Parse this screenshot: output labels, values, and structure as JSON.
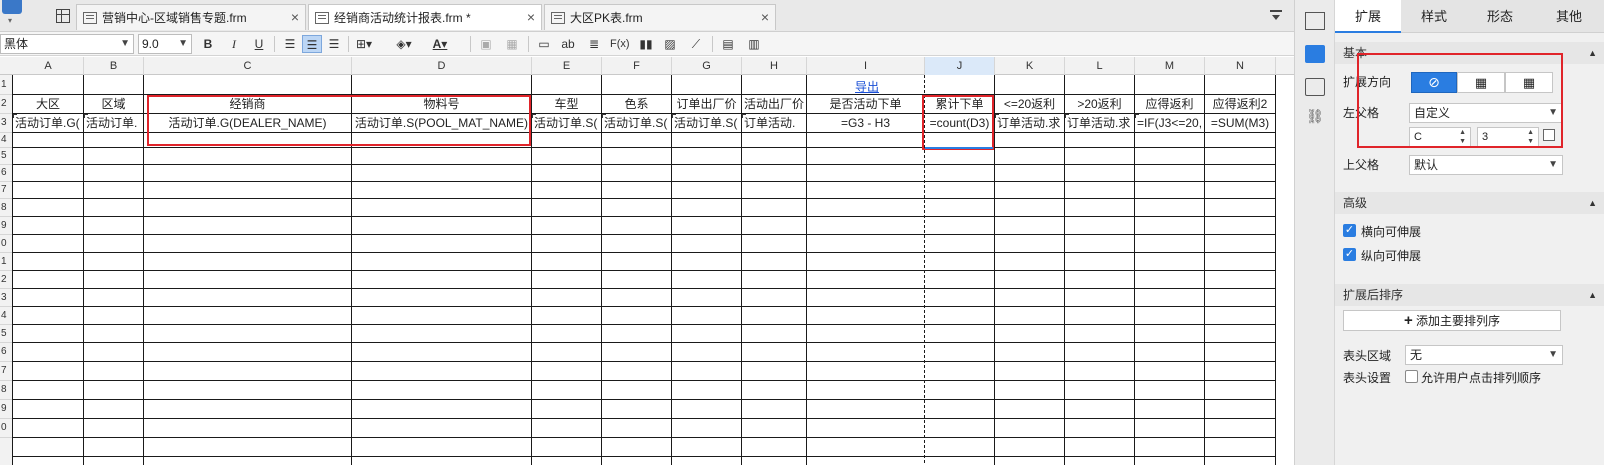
{
  "tabs": [
    {
      "label": "营销中心-区域销售专题.frm",
      "close": "×"
    },
    {
      "label": "经销商活动统计报表.frm *",
      "close": "×"
    },
    {
      "label": "大区PK表.frm",
      "close": "×"
    }
  ],
  "toolbar": {
    "font_name": "黑体",
    "font_size": "9.0",
    "bold": "B",
    "italic": "I",
    "underline": "U",
    "text_icon": "ab",
    "formula": "F(x)"
  },
  "columns": [
    "A",
    "B",
    "C",
    "D",
    "E",
    "F",
    "G",
    "H",
    "I",
    "J",
    "K",
    "L",
    "M",
    "N"
  ],
  "rows": [
    "1",
    "2",
    "3",
    "4",
    "5",
    "6",
    "7",
    "8",
    "9",
    "0",
    "1",
    "2",
    "3",
    "4",
    "5",
    "6",
    "7",
    "8",
    "9",
    "0"
  ],
  "sheet": {
    "export_link": "导出",
    "headers": [
      "大区",
      "区域",
      "经销商",
      "物料号",
      "车型",
      "色系",
      "订单出厂价",
      "活动出厂价",
      "是否活动下单",
      "累计下单",
      "<=20返利",
      ">20返利",
      "应得返利",
      "应得返利2"
    ],
    "row3": [
      "活动订单.G(",
      "活动订单.",
      "活动订单.G(DEALER_NAME)",
      "活动订单.S(POOL_MAT_NAME)",
      "活动订单.S(",
      "活动订单.S(",
      "活动订单.S(",
      "订单活动.",
      "=G3 - H3",
      "=count(D3)",
      "订单活动.求",
      "订单活动.求",
      "=IF(J3<=20,",
      "=SUM(M3)"
    ]
  },
  "panel": {
    "tabs": [
      "扩展",
      "样式",
      "形态",
      "其他"
    ],
    "basic_section": "基本",
    "expand_direction_label": "扩展方向",
    "left_parent_label": "左父格",
    "left_parent_value": "自定义",
    "left_parent_col": "C",
    "left_parent_row": "3",
    "top_parent_label": "上父格",
    "top_parent_value": "默认",
    "advanced_section": "高级",
    "horiz_expand": "横向可伸展",
    "vert_expand": "纵向可伸展",
    "sort_section": "扩展后排序",
    "add_sort_button": "添加主要排列序",
    "header_area_label": "表头区域",
    "header_area_value": "无",
    "header_settings_label": "表头设置",
    "allow_sort_label": "允许用户点击排列顺序"
  },
  "colors": {
    "accent": "#2a7de1",
    "highlight_red": "#e0242a",
    "link": "#1a4fd6"
  }
}
